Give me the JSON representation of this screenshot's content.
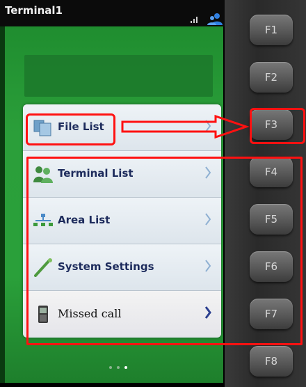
{
  "status_bar": {
    "title": "Terminal1",
    "signal_icon": "signal-bars-icon",
    "user_icon": "user-icon"
  },
  "menu": {
    "items": [
      {
        "label": "File List",
        "icon": "file-list-icon"
      },
      {
        "label": "Terminal List",
        "icon": "terminal-list-icon"
      },
      {
        "label": "Area List",
        "icon": "area-list-icon"
      },
      {
        "label": "System Settings",
        "icon": "system-settings-icon"
      },
      {
        "label": "Missed call",
        "icon": "phone-icon"
      }
    ]
  },
  "page_indicator": {
    "pages": 3,
    "active": 3
  },
  "keypad": {
    "keys": [
      "F1",
      "F2",
      "F3",
      "F4",
      "F5",
      "F6",
      "F7",
      "F8"
    ]
  },
  "colors": {
    "screen_green": "#2aa03a",
    "annotation_red": "#ff1111",
    "label_navy": "#1d2b5c"
  }
}
